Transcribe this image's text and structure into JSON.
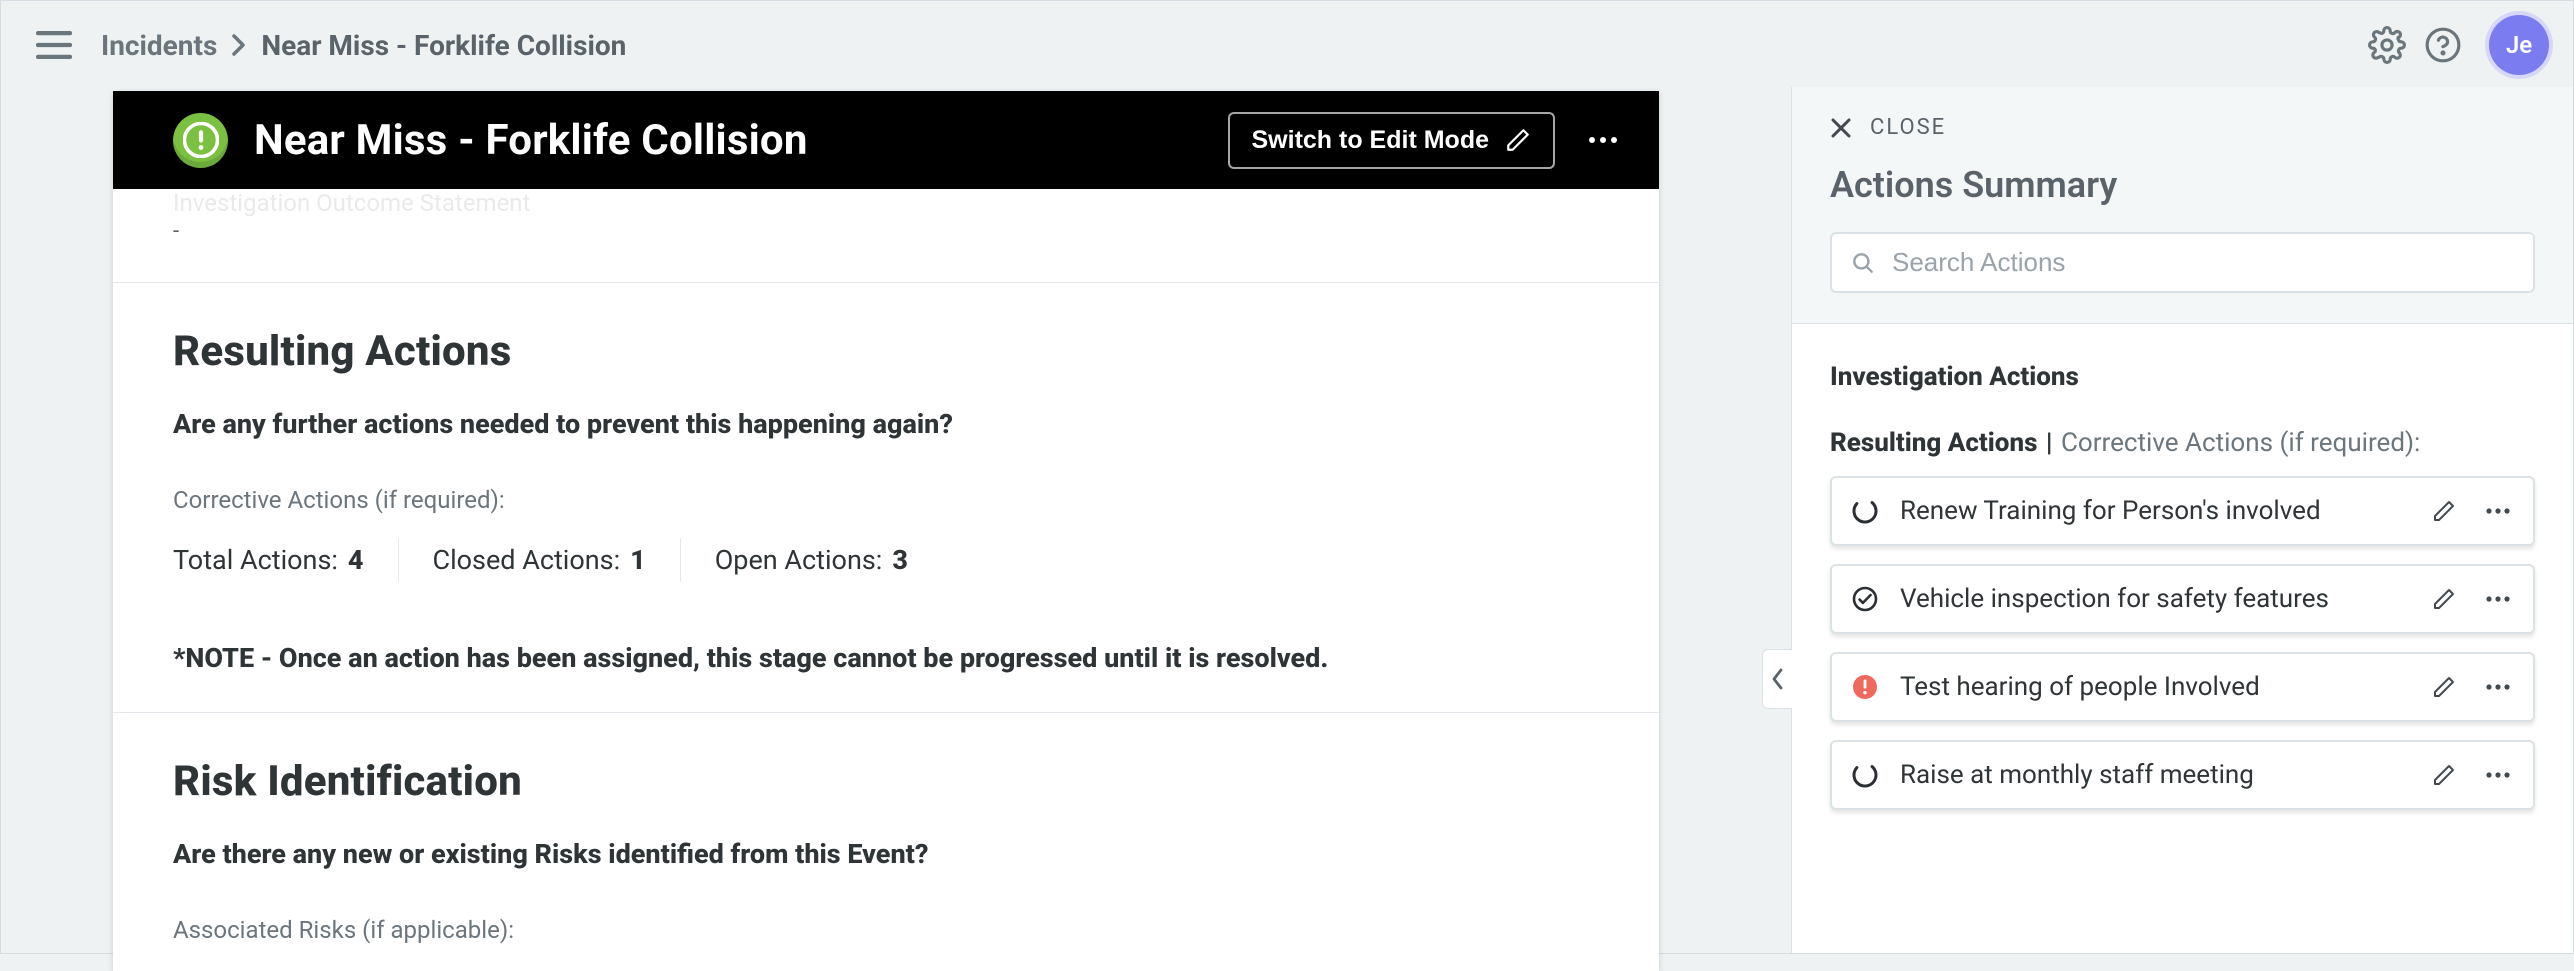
{
  "breadcrumbs": {
    "root": "Incidents",
    "current": "Near Miss - Forklife Collision"
  },
  "avatar_initials": "Je",
  "header": {
    "title": "Near Miss - Forklife Collision",
    "edit_button": "Switch to Edit Mode"
  },
  "outcome": {
    "label": "Investigation Outcome Statement",
    "value": "-"
  },
  "resulting": {
    "title": "Resulting Actions",
    "question": "Are any further actions needed to prevent this happening again?",
    "sublabel": "Corrective Actions (if required):",
    "stats": {
      "total_label": "Total Actions:",
      "total_value": "4",
      "closed_label": "Closed Actions:",
      "closed_value": "1",
      "open_label": "Open Actions:",
      "open_value": "3"
    },
    "note": "*NOTE - Once an action has been assigned, this stage cannot be progressed until it is resolved."
  },
  "risk": {
    "title": "Risk Identification",
    "question": "Are there any new or existing Risks identified from this Event?",
    "sublabel": "Associated Risks (if applicable):"
  },
  "panel": {
    "close_label": "CLOSE",
    "title": "Actions Summary",
    "search_placeholder": "Search Actions",
    "group_title": "Investigation Actions",
    "subgroup_bold": "Resulting Actions",
    "subgroup_sep": " | ",
    "subgroup_light": "Corrective Actions (if required):",
    "actions": [
      {
        "status": "progress",
        "label": "Renew Training for Person's involved"
      },
      {
        "status": "done",
        "label": "Vehicle inspection for safety features"
      },
      {
        "status": "alert",
        "label": "Test hearing of people Involved"
      },
      {
        "status": "progress",
        "label": "Raise at monthly staff meeting"
      }
    ]
  }
}
